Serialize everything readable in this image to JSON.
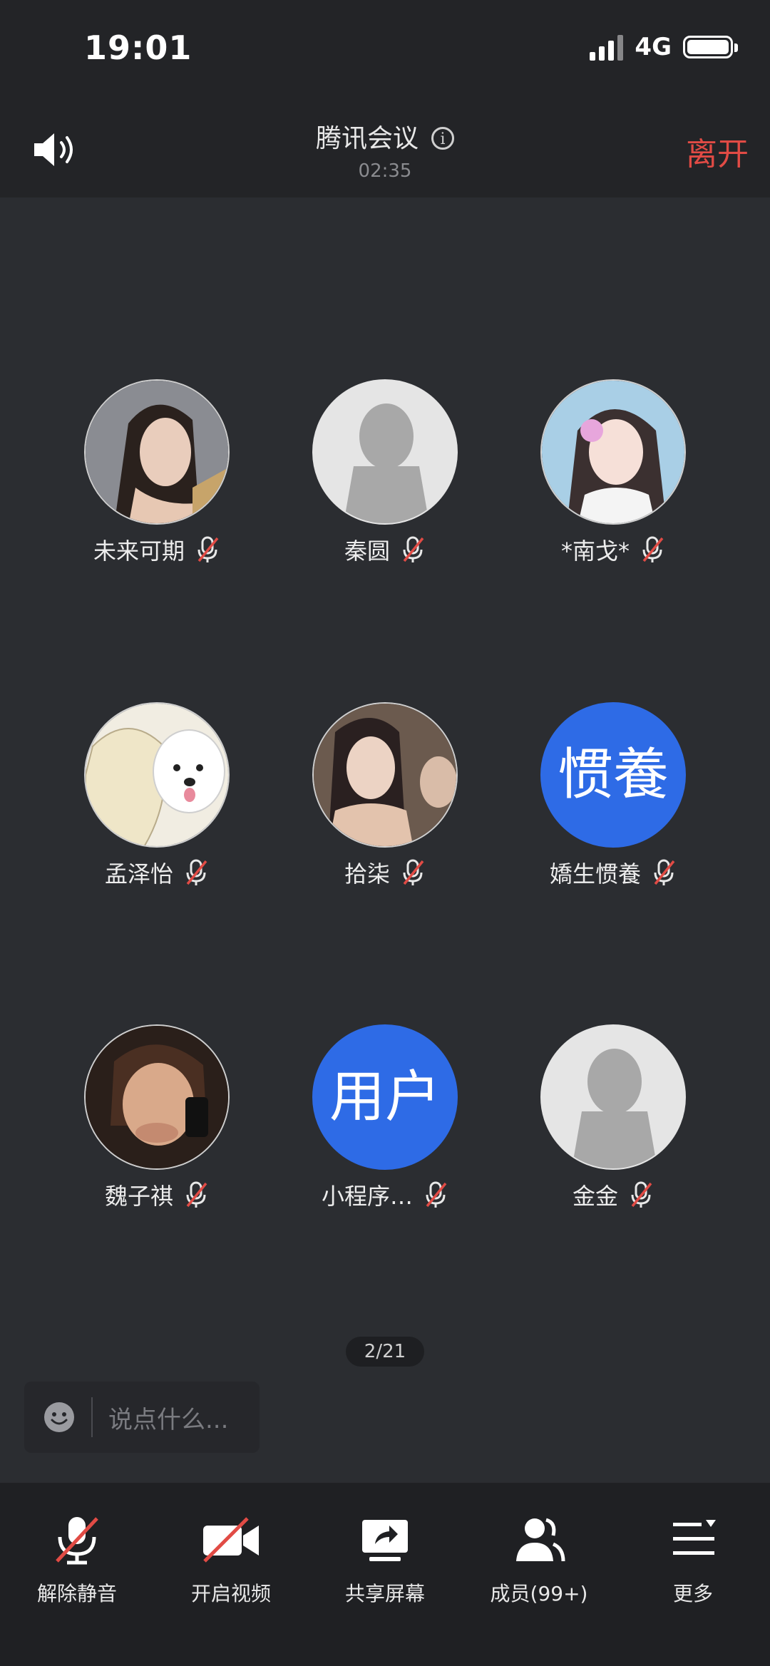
{
  "status_bar": {
    "time": "19:01",
    "network": "4G"
  },
  "header": {
    "title": "腾讯会议",
    "timer": "02:35",
    "leave_label": "离开"
  },
  "participants": [
    {
      "name": "未来可期",
      "avatar": "photo",
      "muted": true
    },
    {
      "name": "秦圆",
      "avatar": "blank",
      "muted": true
    },
    {
      "name": "*南戈*",
      "avatar": "photo",
      "muted": true
    },
    {
      "name": "孟泽怡",
      "avatar": "photo",
      "muted": true
    },
    {
      "name": "拾柒",
      "avatar": "photo",
      "muted": true
    },
    {
      "name": "嬌生惯養",
      "avatar": "text",
      "avatar_text": "惯養",
      "muted": true
    },
    {
      "name": "魏子祺",
      "avatar": "photo",
      "muted": true
    },
    {
      "name": "小程序…",
      "avatar": "text",
      "avatar_text": "用户",
      "muted": true
    },
    {
      "name": "金金",
      "avatar": "blank",
      "muted": true
    }
  ],
  "pager": "2/21",
  "chat": {
    "placeholder": "说点什么..."
  },
  "toolbar": [
    {
      "label": "解除静音",
      "icon": "mic-muted-icon"
    },
    {
      "label": "开启视频",
      "icon": "camera-off-icon"
    },
    {
      "label": "共享屏幕",
      "icon": "share-screen-icon"
    },
    {
      "label": "成员(99+)",
      "icon": "members-icon"
    },
    {
      "label": "更多",
      "icon": "more-menu-icon"
    }
  ],
  "colors": {
    "accent_blue": "#2e6be6",
    "leave_red": "#e14b45",
    "background": "#2b2d31"
  }
}
